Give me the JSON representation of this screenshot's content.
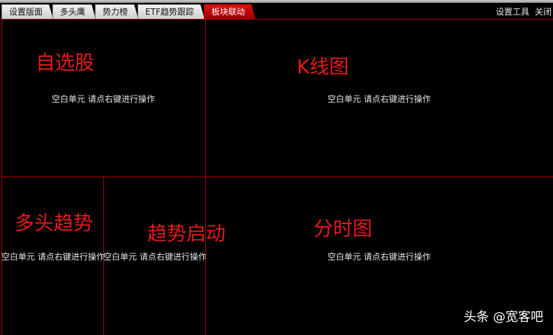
{
  "tabs": [
    {
      "label": "设置版面",
      "active": false
    },
    {
      "label": "多头鹰",
      "active": false
    },
    {
      "label": "势力榜",
      "active": false
    },
    {
      "label": "ETF趋势跟踪",
      "active": false
    },
    {
      "label": "板块联动",
      "active": true
    }
  ],
  "tools": {
    "setup": "设置工具",
    "close": "关闭"
  },
  "panels": {
    "placeholder": "空白单元 请点右键进行操作",
    "watchlist_label": "自选股",
    "kline_label": "K线图",
    "bull_trend_label": "多头趋势",
    "trend_start_label": "趋势启动",
    "intraday_label": "分时图"
  },
  "watermark": "头条 @宽客吧",
  "colors": {
    "background": "#000000",
    "divider": "#b30000",
    "label": "#e31b1b",
    "active_tab": "#c00000"
  }
}
